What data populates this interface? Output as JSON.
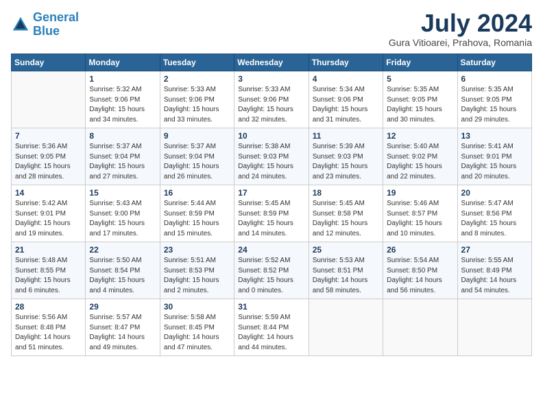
{
  "header": {
    "logo_line1": "General",
    "logo_line2": "Blue",
    "month": "July 2024",
    "location": "Gura Vitioarei, Prahova, Romania"
  },
  "weekdays": [
    "Sunday",
    "Monday",
    "Tuesday",
    "Wednesday",
    "Thursday",
    "Friday",
    "Saturday"
  ],
  "weeks": [
    [
      {
        "num": "",
        "info": ""
      },
      {
        "num": "1",
        "info": "Sunrise: 5:32 AM\nSunset: 9:06 PM\nDaylight: 15 hours\nand 34 minutes."
      },
      {
        "num": "2",
        "info": "Sunrise: 5:33 AM\nSunset: 9:06 PM\nDaylight: 15 hours\nand 33 minutes."
      },
      {
        "num": "3",
        "info": "Sunrise: 5:33 AM\nSunset: 9:06 PM\nDaylight: 15 hours\nand 32 minutes."
      },
      {
        "num": "4",
        "info": "Sunrise: 5:34 AM\nSunset: 9:06 PM\nDaylight: 15 hours\nand 31 minutes."
      },
      {
        "num": "5",
        "info": "Sunrise: 5:35 AM\nSunset: 9:05 PM\nDaylight: 15 hours\nand 30 minutes."
      },
      {
        "num": "6",
        "info": "Sunrise: 5:35 AM\nSunset: 9:05 PM\nDaylight: 15 hours\nand 29 minutes."
      }
    ],
    [
      {
        "num": "7",
        "info": "Sunrise: 5:36 AM\nSunset: 9:05 PM\nDaylight: 15 hours\nand 28 minutes."
      },
      {
        "num": "8",
        "info": "Sunrise: 5:37 AM\nSunset: 9:04 PM\nDaylight: 15 hours\nand 27 minutes."
      },
      {
        "num": "9",
        "info": "Sunrise: 5:37 AM\nSunset: 9:04 PM\nDaylight: 15 hours\nand 26 minutes."
      },
      {
        "num": "10",
        "info": "Sunrise: 5:38 AM\nSunset: 9:03 PM\nDaylight: 15 hours\nand 24 minutes."
      },
      {
        "num": "11",
        "info": "Sunrise: 5:39 AM\nSunset: 9:03 PM\nDaylight: 15 hours\nand 23 minutes."
      },
      {
        "num": "12",
        "info": "Sunrise: 5:40 AM\nSunset: 9:02 PM\nDaylight: 15 hours\nand 22 minutes."
      },
      {
        "num": "13",
        "info": "Sunrise: 5:41 AM\nSunset: 9:01 PM\nDaylight: 15 hours\nand 20 minutes."
      }
    ],
    [
      {
        "num": "14",
        "info": "Sunrise: 5:42 AM\nSunset: 9:01 PM\nDaylight: 15 hours\nand 19 minutes."
      },
      {
        "num": "15",
        "info": "Sunrise: 5:43 AM\nSunset: 9:00 PM\nDaylight: 15 hours\nand 17 minutes."
      },
      {
        "num": "16",
        "info": "Sunrise: 5:44 AM\nSunset: 8:59 PM\nDaylight: 15 hours\nand 15 minutes."
      },
      {
        "num": "17",
        "info": "Sunrise: 5:45 AM\nSunset: 8:59 PM\nDaylight: 15 hours\nand 14 minutes."
      },
      {
        "num": "18",
        "info": "Sunrise: 5:45 AM\nSunset: 8:58 PM\nDaylight: 15 hours\nand 12 minutes."
      },
      {
        "num": "19",
        "info": "Sunrise: 5:46 AM\nSunset: 8:57 PM\nDaylight: 15 hours\nand 10 minutes."
      },
      {
        "num": "20",
        "info": "Sunrise: 5:47 AM\nSunset: 8:56 PM\nDaylight: 15 hours\nand 8 minutes."
      }
    ],
    [
      {
        "num": "21",
        "info": "Sunrise: 5:48 AM\nSunset: 8:55 PM\nDaylight: 15 hours\nand 6 minutes."
      },
      {
        "num": "22",
        "info": "Sunrise: 5:50 AM\nSunset: 8:54 PM\nDaylight: 15 hours\nand 4 minutes."
      },
      {
        "num": "23",
        "info": "Sunrise: 5:51 AM\nSunset: 8:53 PM\nDaylight: 15 hours\nand 2 minutes."
      },
      {
        "num": "24",
        "info": "Sunrise: 5:52 AM\nSunset: 8:52 PM\nDaylight: 15 hours\nand 0 minutes."
      },
      {
        "num": "25",
        "info": "Sunrise: 5:53 AM\nSunset: 8:51 PM\nDaylight: 14 hours\nand 58 minutes."
      },
      {
        "num": "26",
        "info": "Sunrise: 5:54 AM\nSunset: 8:50 PM\nDaylight: 14 hours\nand 56 minutes."
      },
      {
        "num": "27",
        "info": "Sunrise: 5:55 AM\nSunset: 8:49 PM\nDaylight: 14 hours\nand 54 minutes."
      }
    ],
    [
      {
        "num": "28",
        "info": "Sunrise: 5:56 AM\nSunset: 8:48 PM\nDaylight: 14 hours\nand 51 minutes."
      },
      {
        "num": "29",
        "info": "Sunrise: 5:57 AM\nSunset: 8:47 PM\nDaylight: 14 hours\nand 49 minutes."
      },
      {
        "num": "30",
        "info": "Sunrise: 5:58 AM\nSunset: 8:45 PM\nDaylight: 14 hours\nand 47 minutes."
      },
      {
        "num": "31",
        "info": "Sunrise: 5:59 AM\nSunset: 8:44 PM\nDaylight: 14 hours\nand 44 minutes."
      },
      {
        "num": "",
        "info": ""
      },
      {
        "num": "",
        "info": ""
      },
      {
        "num": "",
        "info": ""
      }
    ]
  ]
}
